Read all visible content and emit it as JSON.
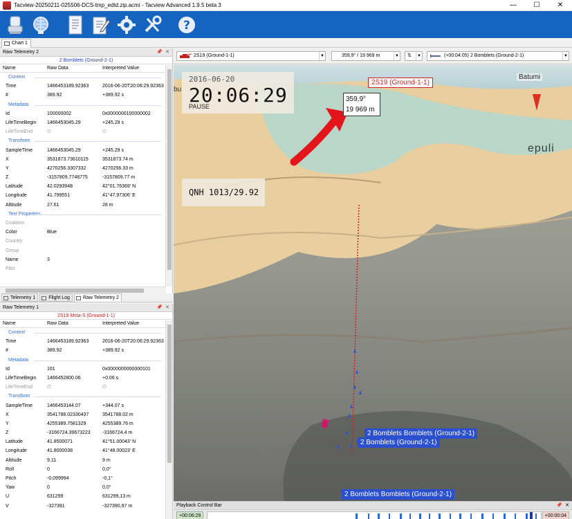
{
  "window": {
    "title": "Tacview-20250211-025506-DCS-tmp_edtd.zip.acmi - Tacview Advanced 1.9.5 beta 3",
    "minimize": "—",
    "maximize": "☐",
    "close": "✕"
  },
  "chart_tab": {
    "label": "Chart 1"
  },
  "panel_top": {
    "title": "Raw Telemetry 2",
    "subject": "2 Bomblets (Ground-2-1)",
    "columns": [
      "Name",
      "Raw Data",
      "Interpreted Value"
    ],
    "sections": [
      {
        "title": "Context",
        "rows": [
          {
            "name": "Time",
            "raw": "1466453189.92363",
            "value": "2016-06-20T20:06:29.92363"
          },
          {
            "name": "#",
            "raw": "389.92",
            "value": "+389.92 s"
          }
        ]
      },
      {
        "title": "Metadata",
        "rows": [
          {
            "name": "Id",
            "raw": "100000002",
            "value": "0x0000000100000002"
          },
          {
            "name": "LifeTimeBegin",
            "raw": "1466453045.29",
            "value": "+245.29 s"
          },
          {
            "name": "LifeTimeEnd",
            "raw": "∅",
            "value": "∅",
            "muted": true
          }
        ]
      },
      {
        "title": "Transform",
        "rows": [
          {
            "name": "SampleTime",
            "raw": "1466453045.29",
            "value": "+245.29 s"
          },
          {
            "name": "X",
            "raw": "3531873.73610115",
            "value": "3531873.74 m"
          },
          {
            "name": "Y",
            "raw": "4270256.3307332",
            "value": "4270256.33 m"
          },
          {
            "name": "Z",
            "raw": "-3157809.7748775",
            "value": "-3157809.77 m"
          },
          {
            "name": "Latitude",
            "raw": "42.0293948",
            "value": "42°01.76369' N"
          },
          {
            "name": "Longitude",
            "raw": "41.799551",
            "value": "41°47.97306' E"
          },
          {
            "name": "Altitude",
            "raw": "27.61",
            "value": "28 m"
          }
        ]
      },
      {
        "title": "Text Properties",
        "rows": [
          {
            "name": "Coalition",
            "raw": "",
            "value": "",
            "muted": true
          },
          {
            "name": "Color",
            "raw": "Blue",
            "value": ""
          },
          {
            "name": "Country",
            "raw": "",
            "value": "",
            "muted": true
          },
          {
            "name": "Group",
            "raw": "",
            "value": "",
            "muted": true
          },
          {
            "name": "Name",
            "raw": "3",
            "value": ""
          },
          {
            "name": "Pilot",
            "raw": "",
            "value": "",
            "muted": true
          }
        ]
      }
    ]
  },
  "lower_tabs": [
    "Telemetry 1",
    "Flight Log",
    "Raw Telemetry 2"
  ],
  "panel_bottom": {
    "title": "Raw Telemetry 1",
    "subject": "2S19 Msta-S (Ground-1-1)",
    "columns": [
      "Name",
      "Raw Data",
      "Interpreted Value"
    ],
    "sections": [
      {
        "title": "Context",
        "rows": [
          {
            "name": "Time",
            "raw": "1466453189.92363",
            "value": "2016-06-20T20:06:29.92363"
          },
          {
            "name": "#",
            "raw": "389.92",
            "value": "+389.92 s"
          }
        ]
      },
      {
        "title": "Metadata",
        "rows": [
          {
            "name": "Id",
            "raw": "101",
            "value": "0x0000000000000101"
          },
          {
            "name": "LifeTimeBegin",
            "raw": "1466452800.06",
            "value": "+0.06 s"
          },
          {
            "name": "LifeTimeEnd",
            "raw": "∅",
            "value": "∅",
            "muted": true
          }
        ]
      },
      {
        "title": "Transform",
        "rows": [
          {
            "name": "SampleTime",
            "raw": "1466453144.07",
            "value": "+344.07 s"
          },
          {
            "name": "X",
            "raw": "3541788.02330437",
            "value": "3541788.02 m"
          },
          {
            "name": "Y",
            "raw": "4255389.7581329",
            "value": "4255389.76 m"
          },
          {
            "name": "Z",
            "raw": "-3166724.39673223",
            "value": "-3166724.4 m"
          },
          {
            "name": "Latitude",
            "raw": "41.8500071",
            "value": "41°51.00043' N"
          },
          {
            "name": "Longitude",
            "raw": "41.8000038",
            "value": "41°48.00023' E"
          },
          {
            "name": "Altitude",
            "raw": "9.11",
            "value": "9 m"
          },
          {
            "name": "Roll",
            "raw": "0",
            "value": "0,0°"
          },
          {
            "name": "Pitch",
            "raw": "-0.099994",
            "value": "-0,1°"
          },
          {
            "name": "Yaw",
            "raw": "0",
            "value": "0,0°"
          },
          {
            "name": "U",
            "raw": "631299",
            "value": "631299,13 m"
          },
          {
            "name": "V",
            "raw": "-327391",
            "value": "-327390,97 m"
          }
        ]
      }
    ]
  },
  "viewport_bar": {
    "left_object": "2S19 (Ground-1-1)",
    "bearing_range": "359,9° / 19 969 m",
    "right_object": "(+00:04:05) 2 Bomblets (Ground-2-1)"
  },
  "viewport": {
    "date": "2016-06-20",
    "time": "20:06:29",
    "status": "PAUSE",
    "qnh": "QNH 1013/29.92",
    "heading_line1": "359,9°",
    "heading_line2": "19 969 m",
    "red_label": "2S19 (Ground-1-1)",
    "batumi_label": "Batumi",
    "partial_label_left": "bu",
    "partial_label_right": "epuli",
    "blue_label_1": "2 Bomblets Bomblets (Ground-2-1)",
    "blue_label_2": "2 Bomblets (Ground-2-1)",
    "blue_label_3": "2 Bomblets Bomblets (Ground-2-1)"
  },
  "playback": {
    "title": "Playback Control Bar",
    "time_left": "+00:06:29",
    "time_right": "+00:00:04"
  },
  "colors": {
    "toolbar": "#1565c0",
    "red_label": "#d02020",
    "blue_label": "#2a4fcf",
    "section": "#3a6ad0"
  }
}
